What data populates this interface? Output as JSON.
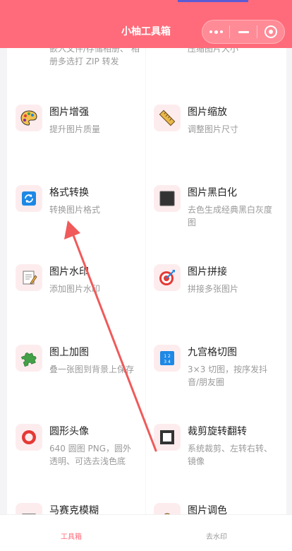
{
  "header": {
    "title": "小柚工具箱"
  },
  "tools": [
    {
      "desc": "嵌入文件/存储相册、 相册多选打 ZIP 转发"
    },
    {
      "desc": "压缩图片大小"
    },
    {
      "name": "图片增强",
      "desc": "提升图片质量",
      "icon": "palette-icon"
    },
    {
      "name": "图片缩放",
      "desc": "调整图片尺寸",
      "icon": "ruler-icon"
    },
    {
      "name": "格式转换",
      "desc": "转换图片格式",
      "icon": "convert-icon"
    },
    {
      "name": "图片黑白化",
      "desc": "去色生成经典黑白灰度图",
      "icon": "black-square-icon"
    },
    {
      "name": "图片水印",
      "desc": "添加图片水印",
      "icon": "memo-icon"
    },
    {
      "name": "图片拼接",
      "desc": "拼接多张图片",
      "icon": "target-icon"
    },
    {
      "name": "图上加图",
      "desc": "叠一张图到背景上保存",
      "icon": "puzzle-icon"
    },
    {
      "name": "九宫格切图",
      "desc": "3×3 切图，按序发抖音/朋友圈",
      "icon": "grid-numbers-icon",
      "grid_text": "1 2 3 4"
    },
    {
      "name": "圆形头像",
      "desc": "640 圆图 PNG，圆外透明、可选去浅色底",
      "icon": "ring-icon"
    },
    {
      "name": "裁剪旋转翻转",
      "desc": "系统裁剪、左转右转、镜像",
      "icon": "frame-icon"
    },
    {
      "name": "马赛克模糊",
      "icon": "mosaic-icon"
    },
    {
      "name": "图片调色",
      "icon": "gear-icon"
    }
  ],
  "tabbar": {
    "tab1": "工具箱",
    "tab2": "去水印"
  },
  "colors": {
    "brand": "#ff6b7a",
    "icon_bg": "#fdecee",
    "annotation": "#f05a5a"
  }
}
